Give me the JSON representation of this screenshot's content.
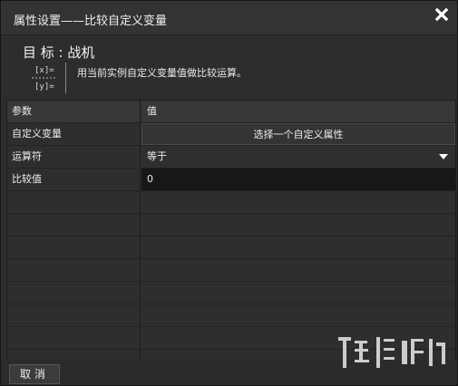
{
  "window": {
    "title": "属性设置——比较自定义变量",
    "close_icon": "close-icon"
  },
  "target": {
    "label": "目  标 : ",
    "name": "战机"
  },
  "description": {
    "icon": "variable-compare-icon",
    "icon_lines": [
      "[x]=",
      "[y]="
    ],
    "text": "用当前实例自定义变量值做比较运算。"
  },
  "grid": {
    "headers": [
      "参数",
      "值"
    ],
    "rows": [
      {
        "param": "自定义变量",
        "value": "选择一个自定义属性",
        "kind": "button"
      },
      {
        "param": "运算符",
        "value": "等于",
        "kind": "select"
      },
      {
        "param": "比较值",
        "value": "0",
        "kind": "input"
      }
    ]
  },
  "footer": {
    "cancel_label": "取消"
  },
  "colors": {
    "background": "#2d2d2d",
    "titlebar": "#333333",
    "grid_header": "#383838",
    "input_bg": "#171717"
  }
}
